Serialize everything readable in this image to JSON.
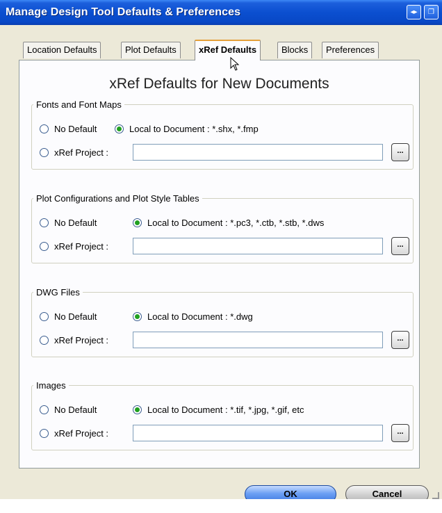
{
  "window": {
    "title": "Manage Design Tool Defaults & Preferences",
    "scroll_icon": "◂▸",
    "restore_icon": "❐"
  },
  "tabs": [
    {
      "label": "Location Defaults",
      "active": false
    },
    {
      "label": "Plot Defaults",
      "active": false
    },
    {
      "label": "xRef Defaults",
      "active": true
    },
    {
      "label": "Blocks",
      "active": false
    },
    {
      "label": "Preferences",
      "active": false
    }
  ],
  "panel": {
    "heading": "xRef Defaults for New Documents"
  },
  "groups": [
    {
      "legend": "Fonts and Font Maps",
      "no_default_label": "No Default",
      "local_label": "Local to Document : *.shx, *.fmp",
      "project_label": "xRef Project :",
      "project_value": "",
      "browse_label": "...",
      "selected": "local"
    },
    {
      "legend": "Plot Configurations and Plot Style Tables",
      "no_default_label": "No Default",
      "local_label": "Local to Document : *.pc3, *.ctb, *.stb, *.dws",
      "project_label": "xRef Project :",
      "project_value": "",
      "browse_label": "...",
      "selected": "local"
    },
    {
      "legend": "DWG Files",
      "no_default_label": "No Default",
      "local_label": "Local to Document : *.dwg",
      "project_label": "xRef Project :",
      "project_value": "",
      "browse_label": "...",
      "selected": "local"
    },
    {
      "legend": "Images",
      "no_default_label": "No Default",
      "local_label": "Local to Document : *.tif, *.jpg, *.gif, etc",
      "project_label": "xRef Project :",
      "project_value": "",
      "browse_label": "...",
      "selected": "local"
    }
  ],
  "buttons": {
    "ok_label": "OK",
    "cancel_label": "Cancel"
  },
  "colors": {
    "titlebar": "#0b4fd0",
    "active_tab_accent": "#e5a03a",
    "selected_radio": "#20a020",
    "ok_button": "#3b77e0"
  }
}
